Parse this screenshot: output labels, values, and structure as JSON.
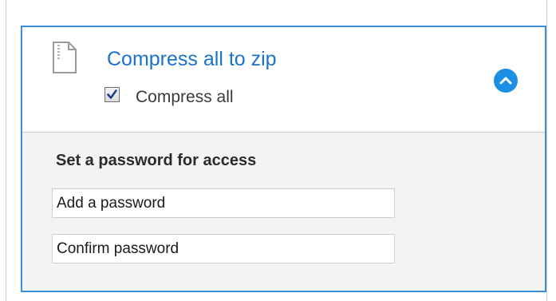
{
  "panel": {
    "title": "Compress all to zip",
    "checkbox": {
      "label": "Compress all",
      "checked": true
    },
    "collapse_icon": "chevron-up-icon",
    "file_icon": "zip-file-icon",
    "accent_color": "#1a8fe3",
    "title_color": "#1a73c8",
    "border_color": "#3a8fd6"
  },
  "password_section": {
    "heading": "Set a password for access",
    "password_field": {
      "placeholder": "Add a password",
      "value": ""
    },
    "confirm_field": {
      "placeholder": "Confirm password",
      "value": ""
    }
  }
}
